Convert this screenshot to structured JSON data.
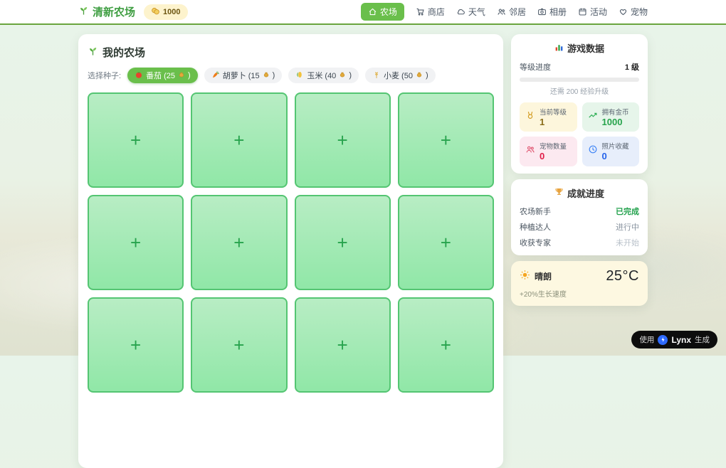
{
  "app": {
    "title": "清新农场",
    "coins": "1000"
  },
  "nav": {
    "items": [
      {
        "label": "农场",
        "active": true
      },
      {
        "label": "商店",
        "active": false
      },
      {
        "label": "天气",
        "active": false
      },
      {
        "label": "邻居",
        "active": false
      },
      {
        "label": "相册",
        "active": false
      },
      {
        "label": "活动",
        "active": false
      },
      {
        "label": "宠物",
        "active": false
      }
    ]
  },
  "farm": {
    "title": "我的农场",
    "seed_label": "选择种子:",
    "plot_plus": "+",
    "seeds": [
      {
        "name": "番茄",
        "cost": 25,
        "pre": "番茄 (25",
        "post": ")",
        "icon": "tomato-icon",
        "active": true
      },
      {
        "name": "胡萝卜",
        "cost": 15,
        "pre": "胡萝卜 (15",
        "post": ")",
        "icon": "carrot-icon",
        "active": false
      },
      {
        "name": "玉米",
        "cost": 40,
        "pre": "玉米 (40",
        "post": ")",
        "icon": "corn-icon",
        "active": false
      },
      {
        "name": "小麦",
        "cost": 50,
        "pre": "小麦 (50",
        "post": ")",
        "icon": "wheat-icon",
        "active": false
      }
    ]
  },
  "stats_panel": {
    "title": "游戏数据",
    "level_label": "等级进度",
    "level_value": "1 级",
    "progress_percent": 0,
    "xp_hint": "还需 200 经验升级",
    "cards": [
      {
        "label": "当前等级",
        "value": "1",
        "theme": "yellow",
        "icon": "medal-icon"
      },
      {
        "label": "拥有金币",
        "value": "1000",
        "theme": "green",
        "icon": "trend-up-icon"
      },
      {
        "label": "宠物数量",
        "value": "0",
        "theme": "pink",
        "icon": "users-icon"
      },
      {
        "label": "照片收藏",
        "value": "0",
        "theme": "blue",
        "icon": "clock-icon"
      }
    ]
  },
  "achievements": {
    "title": "成就进度",
    "items": [
      {
        "name": "农场新手",
        "status": "已完成"
      },
      {
        "name": "种植达人",
        "status": "进行中"
      },
      {
        "name": "收获专家",
        "status": "未开始"
      }
    ]
  },
  "weather": {
    "condition": "晴朗",
    "temperature": "25°C",
    "bonus": "+20%生长速度"
  },
  "badge": {
    "prefix": "使用",
    "brand": "Lynx",
    "suffix": "生成"
  },
  "colors": {
    "accent_green": "#6abf4b",
    "navbar_border": "#6aa53e",
    "plot_border": "#54c572",
    "coin_badge_bg": "#fdf3cd",
    "weather_bg": "#fdf8e1"
  }
}
